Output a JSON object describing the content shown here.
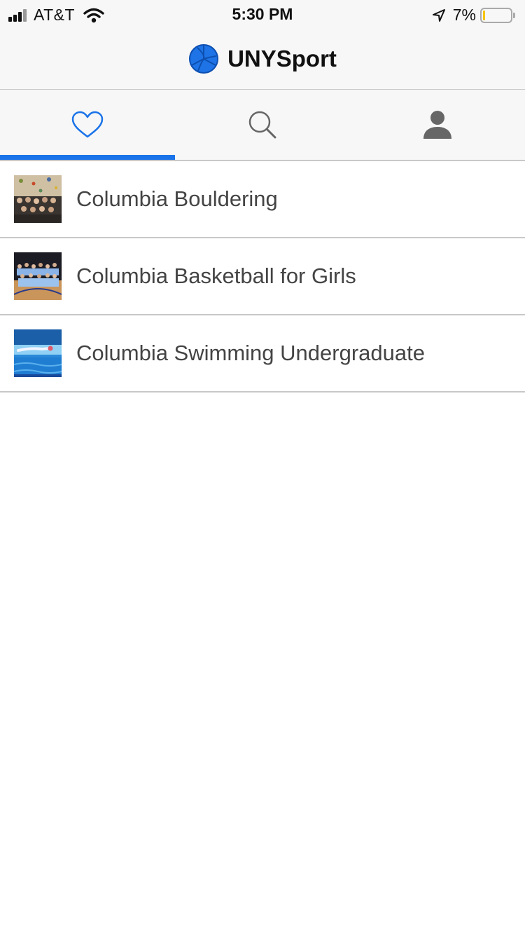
{
  "status_bar": {
    "carrier": "AT&T",
    "time": "5:30 PM",
    "battery_percent": "7%",
    "battery_level": 0.07,
    "icons": [
      "signal-icon",
      "wifi-icon",
      "location-arrow-icon",
      "battery-icon"
    ]
  },
  "header": {
    "title": "UNYSport",
    "logo_icon": "volleyball-logo-icon"
  },
  "tabs": [
    {
      "icon": "heart-icon",
      "active": true
    },
    {
      "icon": "search-icon",
      "active": false
    },
    {
      "icon": "person-icon",
      "active": false
    }
  ],
  "list": {
    "items": [
      {
        "label": "Columbia Bouldering",
        "thumbnail": "bouldering-thumbnail"
      },
      {
        "label": "Columbia Basketball for Girls",
        "thumbnail": "basketball-thumbnail"
      },
      {
        "label": "Columbia Swimming Undergraduate",
        "thumbnail": "swimming-thumbnail"
      }
    ]
  },
  "colors": {
    "accent": "#1a73e8",
    "logo_blue": "#1e74e6",
    "icon_gray": "#666666",
    "battery_yellow": "#f5c400"
  }
}
